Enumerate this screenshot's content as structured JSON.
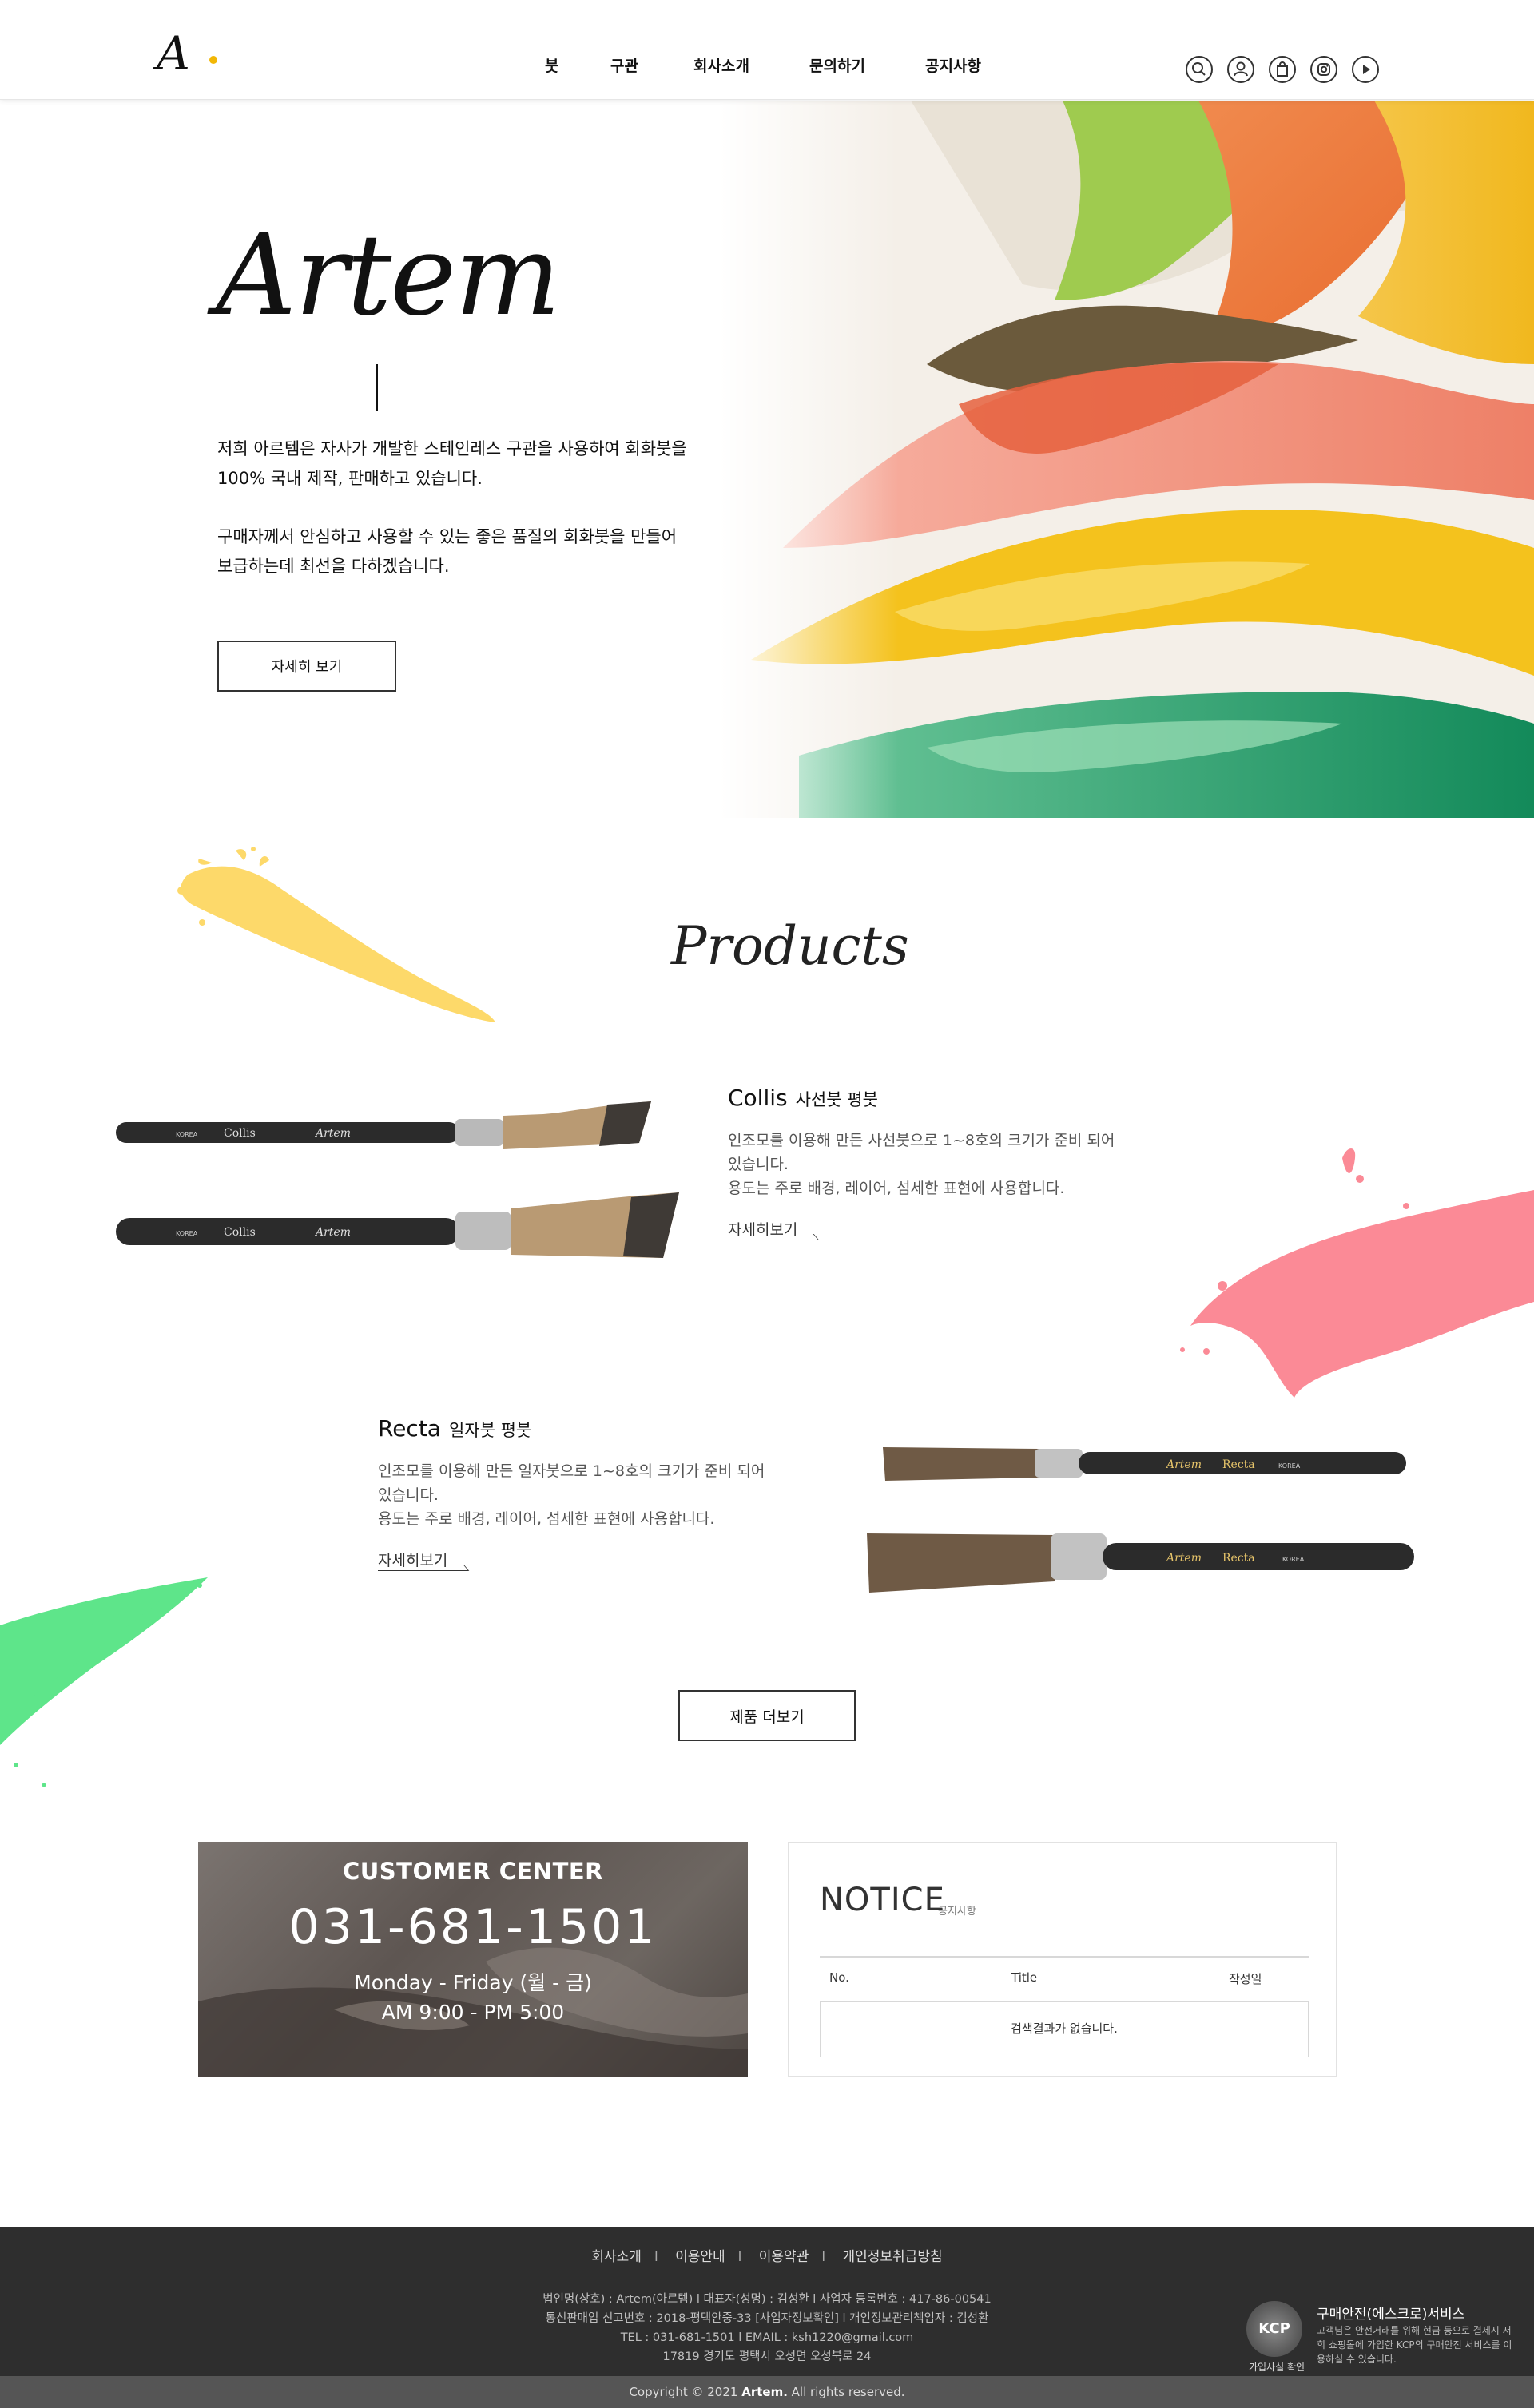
{
  "header": {
    "logo": "A",
    "nav": [
      "붓",
      "구관",
      "회사소개",
      "문의하기",
      "공지사항"
    ],
    "icons": [
      "search-icon",
      "user-icon",
      "cart-icon",
      "instagram-icon",
      "play-icon"
    ]
  },
  "hero": {
    "title": "Artem",
    "paragraph1_line1": "저희 아르템은 자사가 개발한 스테인레스 구관을 사용하여 회화붓을",
    "paragraph1_line2": "100% 국내 제작, 판매하고 있습니다.",
    "paragraph2_line1": "구매자께서 안심하고 사용할 수 있는 좋은 품질의 회화붓을 만들어",
    "paragraph2_line2": "보급하는데 최선을 다하겠습니다.",
    "button": "자세히 보기"
  },
  "products": {
    "title": "Products",
    "items": [
      {
        "name": "Collis",
        "type": "사선붓 평붓",
        "desc_line1": "인조모를 이용해 만든 사선붓으로 1~8호의 크기가 준비 되어",
        "desc_line2": "있습니다.",
        "desc_line3": "용도는 주로 배경, 레이어, 섬세한 표현에 사용합니다.",
        "link": "자세히보기",
        "brush_label": "Collis",
        "brush_brand": "Artem",
        "brush_country": "KOREA"
      },
      {
        "name": "Recta",
        "type": "일자붓 평붓",
        "desc_line1": "인조모를 이용해 만든 일자붓으로 1~8호의 크기가 준비 되어",
        "desc_line2": "있습니다.",
        "desc_line3": "용도는 주로 배경, 레이어, 섬세한 표현에 사용합니다.",
        "link": "자세히보기",
        "brush_label": "Recta",
        "brush_brand": "Artem",
        "brush_country": "KOREA"
      }
    ],
    "more_button": "제품 더보기"
  },
  "customer_center": {
    "title": "CUSTOMER CENTER",
    "phone": "031-681-1501",
    "days": "Monday - Friday (월 - 금)",
    "hours": "AM 9:00 - PM 5:00"
  },
  "notice": {
    "title": "NOTICE",
    "subtitle": "공지사항",
    "col_no": "No.",
    "col_title": "Title",
    "col_date": "작성일",
    "empty": "검색결과가 없습니다."
  },
  "footer": {
    "links": [
      "회사소개",
      "이용안내",
      "이용약관",
      "개인정보취급방침"
    ],
    "info_line1": "법인명(상호) : Artem(아르템)   l   대표자(성명) : 김성환   l   사업자 등록번호 : 417-86-00541",
    "info_line2": "통신판매업 신고번호 : 2018-평택안중-33   [사업자정보확인]   l   개인정보관리책임자 : 김성환",
    "info_line3": "TEL : 031-681-1501   l   EMAIL : ksh1220@gmail.com",
    "info_line4": "17819 경기도 평택시 오성면 오성북로 24",
    "copyright_prefix": "Copyright © 2021 ",
    "copyright_brand": "Artem.",
    "copyright_suffix": " All rights reserved.",
    "kcp_badge": "KCP",
    "kcp_label": "가입사실 확인",
    "kcp_title": "구매안전(에스크로)서비스",
    "kcp_desc": "고객님은 안전거래를 위해 현금 등으로 결제시 저희 쇼핑몰에 가입한 KCP의 구매안전 서비스를 이용하실 수 있습니다."
  },
  "colors": {
    "yellow_splash": "#fdd96a",
    "pink_splash": "#fb8a96",
    "green_splash": "#5ee58a",
    "footer_bg": "#2e2e2e"
  }
}
